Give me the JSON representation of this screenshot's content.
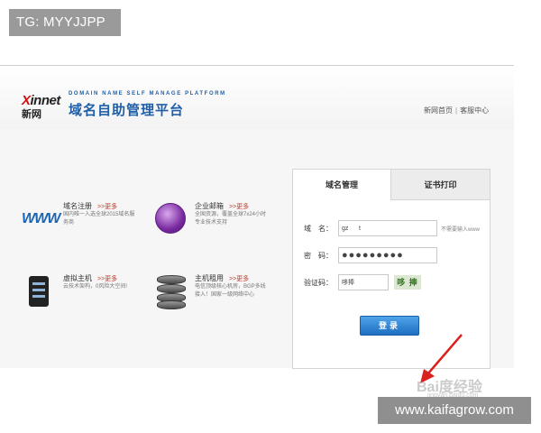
{
  "overlay": {
    "top_label": "TG: MYYJJPP",
    "bottom_label": "www.kaifagrow.com"
  },
  "header": {
    "logo_brand_x": "X",
    "logo_brand_rest": "innet",
    "logo_cn": "新网",
    "slogan_en": "DOMAIN NAME SELF MANAGE PLATFORM",
    "slogan_cn": "域名自助管理平台",
    "links": [
      {
        "label": "新网首页"
      },
      {
        "label": "客服中心"
      }
    ],
    "link_separator": "|"
  },
  "services": [
    {
      "icon": "www-icon",
      "title": "域名注册",
      "more": ">>更多",
      "desc": "国内唯一入选全球2015域名服务商"
    },
    {
      "icon": "globe-icon",
      "title": "企业邮箱",
      "more": ">>更多",
      "desc": "全国资源，覆盖全球7x24小时专业技术支持"
    },
    {
      "icon": "server-icon",
      "title": "虚拟主机",
      "more": ">>更多",
      "desc": "云技术架构，0风险大空间!"
    },
    {
      "icon": "server-stack-icon",
      "title": "主机租用",
      "more": ">>更多",
      "desc": "电信顶级核心机房，BGP多线接入！国家一级网络中心"
    }
  ],
  "login": {
    "tabs": [
      {
        "label": "域名管理",
        "active": true
      },
      {
        "label": "证书打印",
        "active": false
      }
    ],
    "domain_label": "域　名：",
    "domain_value": "gz      t",
    "domain_hint": "不需要输入www",
    "password_label": "密　码：",
    "password_value": "●●●●●●●●●",
    "captcha_label": "验证码：",
    "captcha_value": "哆捧",
    "captcha_image_text": "哆 捧",
    "submit_label": "登录"
  },
  "watermark": {
    "main": "Bai度经验",
    "sub": "jingyan.baidu.com"
  },
  "colors": {
    "brand_blue": "#1f5fa8",
    "button_blue": "#1e6fc2",
    "arrow_red": "#d9221c",
    "more_red": "#c0392b"
  }
}
